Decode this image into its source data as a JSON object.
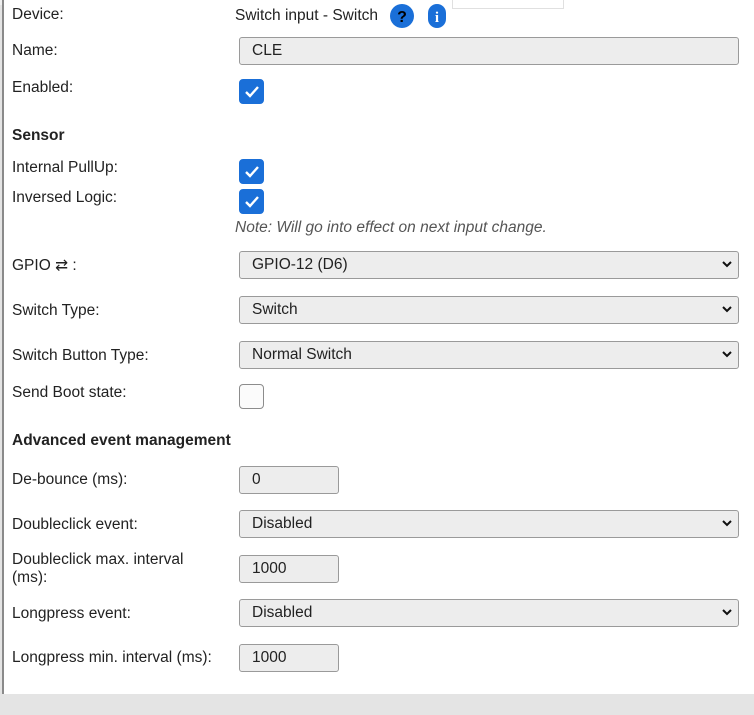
{
  "device": {
    "label": "Device:",
    "value": "Switch input - Switch",
    "help_icon": "help-icon",
    "info_icon": "info-icon"
  },
  "name": {
    "label": "Name:",
    "value": "CLE"
  },
  "enabled": {
    "label": "Enabled:",
    "checked": true
  },
  "sensor": {
    "heading": "Sensor",
    "internal_pullup": {
      "label": "Internal PullUp:",
      "checked": true
    },
    "inversed_logic": {
      "label": "Inversed Logic:",
      "checked": true
    },
    "note": "Note: Will go into effect on next input change.",
    "gpio": {
      "label": "GPIO ⇄ :",
      "value": "GPIO-12 (D6)"
    },
    "switch_type": {
      "label": "Switch Type:",
      "value": "Switch"
    },
    "switch_button_type": {
      "label": "Switch Button Type:",
      "value": "Normal Switch"
    },
    "send_boot_state": {
      "label": "Send Boot state:",
      "checked": false
    }
  },
  "advanced": {
    "heading": "Advanced event management",
    "debounce": {
      "label": "De-bounce (ms):",
      "value": "0"
    },
    "doubleclick_event": {
      "label": "Doubleclick event:",
      "value": "Disabled"
    },
    "doubleclick_interval": {
      "label_line1": "Doubleclick max. interval",
      "label_line2": "(ms):",
      "value": "1000"
    },
    "longpress_event": {
      "label": "Longpress event:",
      "value": "Disabled"
    },
    "longpress_interval": {
      "label": "Longpress min. interval (ms):",
      "value": "1000"
    }
  },
  "colors": {
    "accent": "#1a6fd8",
    "field_bg": "#ededed",
    "page_bg": "#e4e4e4"
  }
}
